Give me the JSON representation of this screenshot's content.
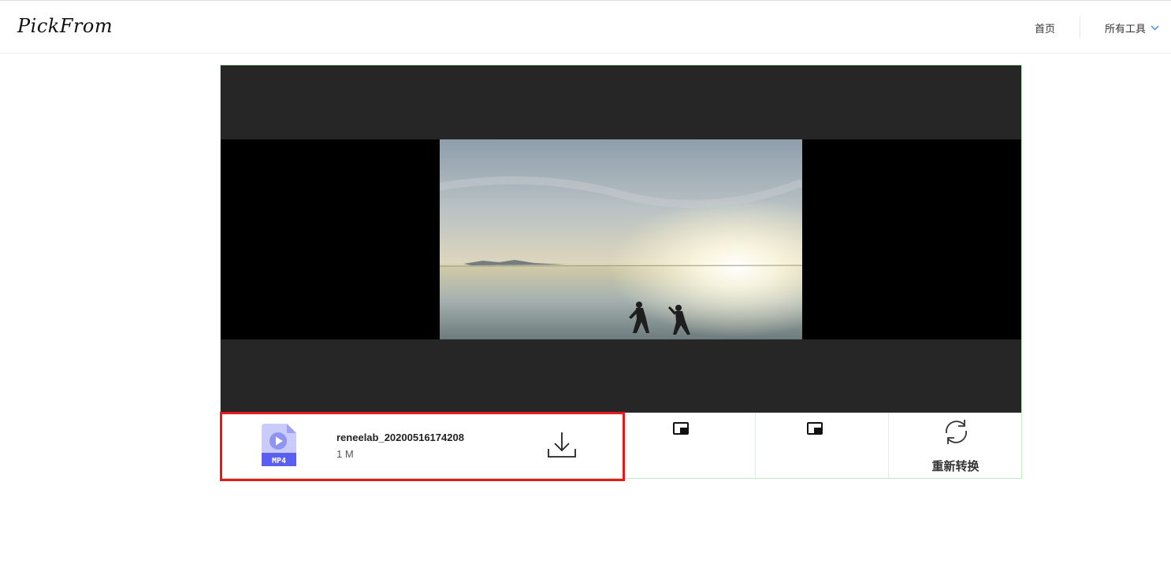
{
  "header": {
    "logo_text": "PickFrom",
    "nav_home": "首页",
    "nav_tools": "所有工具"
  },
  "player": {
    "thumbnail": "salt-flat-sunset-two-figures"
  },
  "file": {
    "type_label": "MP4",
    "name": "reneelab_20200516174208",
    "size": "1 M",
    "icon": "mp4-file-icon",
    "download_icon": "download-icon"
  },
  "tools": {
    "tool1_icon": "picture-in-picture-icon",
    "tool2_icon": "picture-in-picture-icon",
    "reconvert_icon": "refresh-icon",
    "reconvert_label": "重新转换"
  },
  "colors": {
    "highlight_border": "#e8191d",
    "accent_blue": "#3b8ee8",
    "file_icon_purple": "#5b5ff0"
  }
}
